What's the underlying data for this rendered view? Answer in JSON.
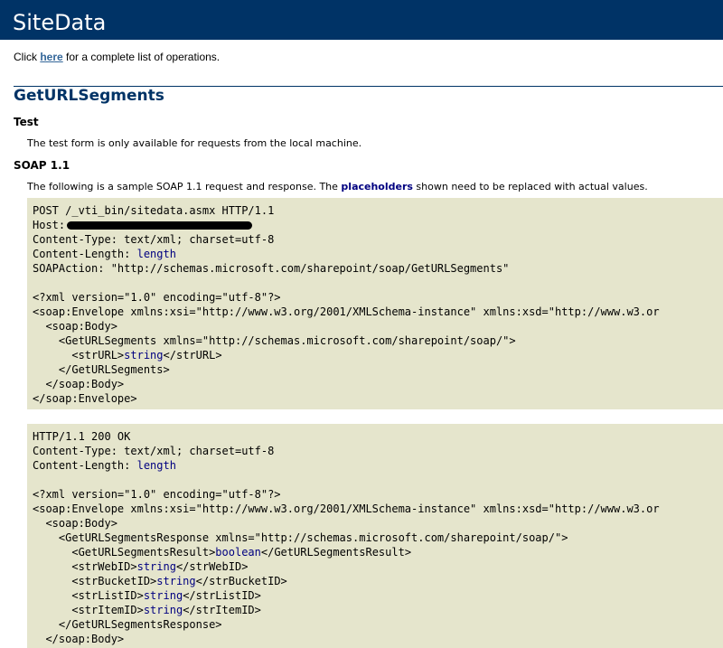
{
  "page": {
    "title": "SiteData",
    "intro_prefix": "Click ",
    "intro_link": "here",
    "intro_suffix": " for a complete list of operations."
  },
  "operation": {
    "name": "GetURLSegments",
    "test_heading": "Test",
    "test_text": "The test form is only available for requests from the local machine.",
    "soap_heading": "SOAP 1.1",
    "soap_text_prefix": "The following is a sample SOAP 1.1 request and response.  The ",
    "soap_text_link": "placeholders",
    "soap_text_suffix": " shown need to be replaced with actual values."
  },
  "request": {
    "line1": "POST /_vti_bin/sitedata.asmx HTTP/1.1",
    "host_label": "Host:",
    "content_type": "Content-Type: text/xml; charset=utf-8",
    "content_length_label": "Content-Length: ",
    "content_length_value": "length",
    "soap_action": "SOAPAction: \"http://schemas.microsoft.com/sharepoint/soap/GetURLSegments\"",
    "xml_decl": "<?xml version=\"1.0\" encoding=\"utf-8\"?>",
    "envelope_open": "<soap:Envelope xmlns:xsi=\"http://www.w3.org/2001/XMLSchema-instance\" xmlns:xsd=\"http://www.w3.or",
    "body_open": "  <soap:Body>",
    "method_open": "    <GetURLSegments xmlns=\"http://schemas.microsoft.com/sharepoint/soap/\">",
    "str_url_open": "      <strURL>",
    "str_url_value": "string",
    "str_url_close": "</strURL>",
    "method_close": "    </GetURLSegments>",
    "body_close": "  </soap:Body>",
    "envelope_close": "</soap:Envelope>"
  },
  "response": {
    "status": "HTTP/1.1 200 OK",
    "content_type": "Content-Type: text/xml; charset=utf-8",
    "content_length_label": "Content-Length: ",
    "content_length_value": "length",
    "xml_decl": "<?xml version=\"1.0\" encoding=\"utf-8\"?>",
    "envelope_open": "<soap:Envelope xmlns:xsi=\"http://www.w3.org/2001/XMLSchema-instance\" xmlns:xsd=\"http://www.w3.or",
    "body_open": "  <soap:Body>",
    "resp_open": "    <GetURLSegmentsResponse xmlns=\"http://schemas.microsoft.com/sharepoint/soap/\">",
    "fields": [
      {
        "open": "      <GetURLSegmentsResult>",
        "value": "boolean",
        "close": "</GetURLSegmentsResult>"
      },
      {
        "open": "      <strWebID>",
        "value": "string",
        "close": "</strWebID>"
      },
      {
        "open": "      <strBucketID>",
        "value": "string",
        "close": "</strBucketID>"
      },
      {
        "open": "      <strListID>",
        "value": "string",
        "close": "</strListID>"
      },
      {
        "open": "      <strItemID>",
        "value": "string",
        "close": "</strItemID>"
      }
    ],
    "resp_close": "    </GetURLSegmentsResponse>",
    "body_close": "  </soap:Body>"
  }
}
